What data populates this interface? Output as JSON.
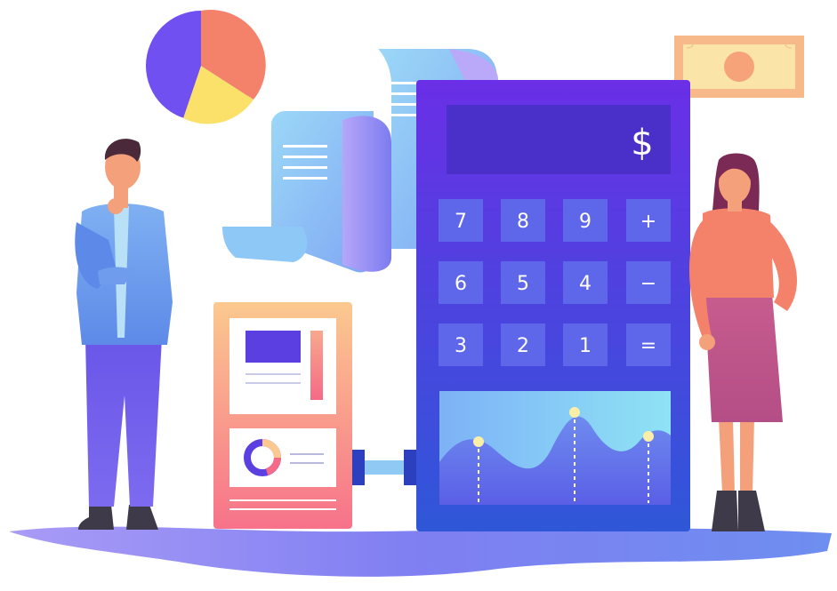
{
  "calculator": {
    "display_symbol": "$",
    "keys": [
      {
        "label": "7"
      },
      {
        "label": "8"
      },
      {
        "label": "9"
      },
      {
        "label": "+"
      },
      {
        "label": "6"
      },
      {
        "label": "5"
      },
      {
        "label": "4"
      },
      {
        "label": "−"
      },
      {
        "label": "3"
      },
      {
        "label": "2"
      },
      {
        "label": "1"
      },
      {
        "label": "="
      }
    ]
  },
  "colors": {
    "calculator_top": "#6A2FE6",
    "calculator_bottom": "#2F57D8",
    "key": "#5E66EA",
    "display": "#4A2FC9",
    "pie_purple": "#7050F0",
    "pie_coral": "#F4826A",
    "pie_yellow": "#FBE06A",
    "ground": "#8C8CF5",
    "banknote": "#FBE4A8",
    "banknote_border": "#F7B98A"
  },
  "icons": [
    "pie-chart-icon",
    "banknote-icon",
    "receipt-paper-icon",
    "donut-chart-icon",
    "area-chart-icon"
  ]
}
